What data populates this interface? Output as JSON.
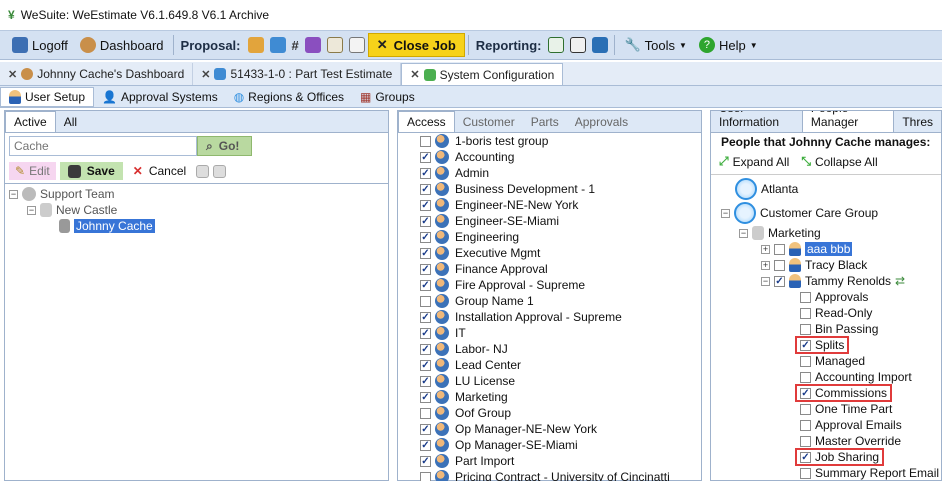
{
  "window": {
    "title": "WeSuite: WeEstimate V6.1.649.8 V6.1 Archive"
  },
  "toolbar": {
    "logoff": "Logoff",
    "dashboard": "Dashboard",
    "proposal_label": "Proposal:",
    "close_job": "Close Job",
    "reporting_label": "Reporting:",
    "tools": "Tools",
    "help": "Help"
  },
  "doc_tabs": [
    {
      "label": "Johnny Cache's Dashboard"
    },
    {
      "label": "51433-1-0 : Part Test Estimate"
    },
    {
      "label": "System Configuration"
    }
  ],
  "sub_tabs": [
    {
      "label": "User Setup"
    },
    {
      "label": "Approval Systems"
    },
    {
      "label": "Regions & Offices"
    },
    {
      "label": "Groups"
    }
  ],
  "left": {
    "tabs": [
      "Active",
      "All"
    ],
    "search_placeholder": "Cache",
    "go": "Go!",
    "edit": "Edit",
    "save": "Save",
    "cancel": "Cancel",
    "tree": [
      "Support Team",
      "New Castle",
      "Johnny Cache"
    ]
  },
  "middle": {
    "tabs": [
      "Access",
      "Customer",
      "Parts",
      "Approvals"
    ],
    "groups": [
      {
        "label": "1-boris test group",
        "checked": false
      },
      {
        "label": "Accounting",
        "checked": true
      },
      {
        "label": "Admin",
        "checked": true
      },
      {
        "label": "Business Development - 1",
        "checked": true
      },
      {
        "label": "Engineer-NE-New York",
        "checked": true
      },
      {
        "label": "Engineer-SE-Miami",
        "checked": true
      },
      {
        "label": "Engineering",
        "checked": true
      },
      {
        "label": "Executive Mgmt",
        "checked": true
      },
      {
        "label": "Finance Approval",
        "checked": true
      },
      {
        "label": "Fire Approval - Supreme",
        "checked": true
      },
      {
        "label": "Group Name 1",
        "checked": false
      },
      {
        "label": "Installation Approval - Supreme",
        "checked": true
      },
      {
        "label": "IT",
        "checked": true
      },
      {
        "label": "Labor- NJ",
        "checked": true
      },
      {
        "label": "Lead Center",
        "checked": true
      },
      {
        "label": "LU License",
        "checked": true
      },
      {
        "label": "Marketing",
        "checked": true
      },
      {
        "label": "Oof Group",
        "checked": false
      },
      {
        "label": "Op Manager-NE-New York",
        "checked": true
      },
      {
        "label": "Op Manager-SE-Miami",
        "checked": true
      },
      {
        "label": "Part Import",
        "checked": true
      },
      {
        "label": "Pricing Contract - University of Cincinatti",
        "checked": false
      }
    ]
  },
  "right": {
    "tabs": [
      "User Information",
      "People Manager",
      "Thres"
    ],
    "heading": "People that Johnny Cache manages:",
    "expand_all": "Expand All",
    "collapse_all": "Collapse All",
    "atlanta": "Atlanta",
    "customer_care": "Customer Care Group",
    "marketing": "Marketing",
    "people": [
      "aaa bbb",
      "Tracy  Black",
      "Tammy Renolds"
    ],
    "permissions": [
      {
        "label": "Approvals",
        "checked": false,
        "highlight": false
      },
      {
        "label": "Read-Only",
        "checked": false,
        "highlight": false
      },
      {
        "label": "Bin Passing",
        "checked": false,
        "highlight": false
      },
      {
        "label": "Splits",
        "checked": true,
        "highlight": true
      },
      {
        "label": "Managed",
        "checked": false,
        "highlight": false
      },
      {
        "label": "Accounting Import",
        "checked": false,
        "highlight": false
      },
      {
        "label": "Commissions",
        "checked": true,
        "highlight": true
      },
      {
        "label": "One Time Part",
        "checked": false,
        "highlight": false
      },
      {
        "label": "Approval Emails",
        "checked": false,
        "highlight": false
      },
      {
        "label": "Master Override",
        "checked": false,
        "highlight": false
      },
      {
        "label": "Job Sharing",
        "checked": true,
        "highlight": true
      },
      {
        "label": "Summary Report Email",
        "checked": false,
        "highlight": false
      }
    ]
  }
}
